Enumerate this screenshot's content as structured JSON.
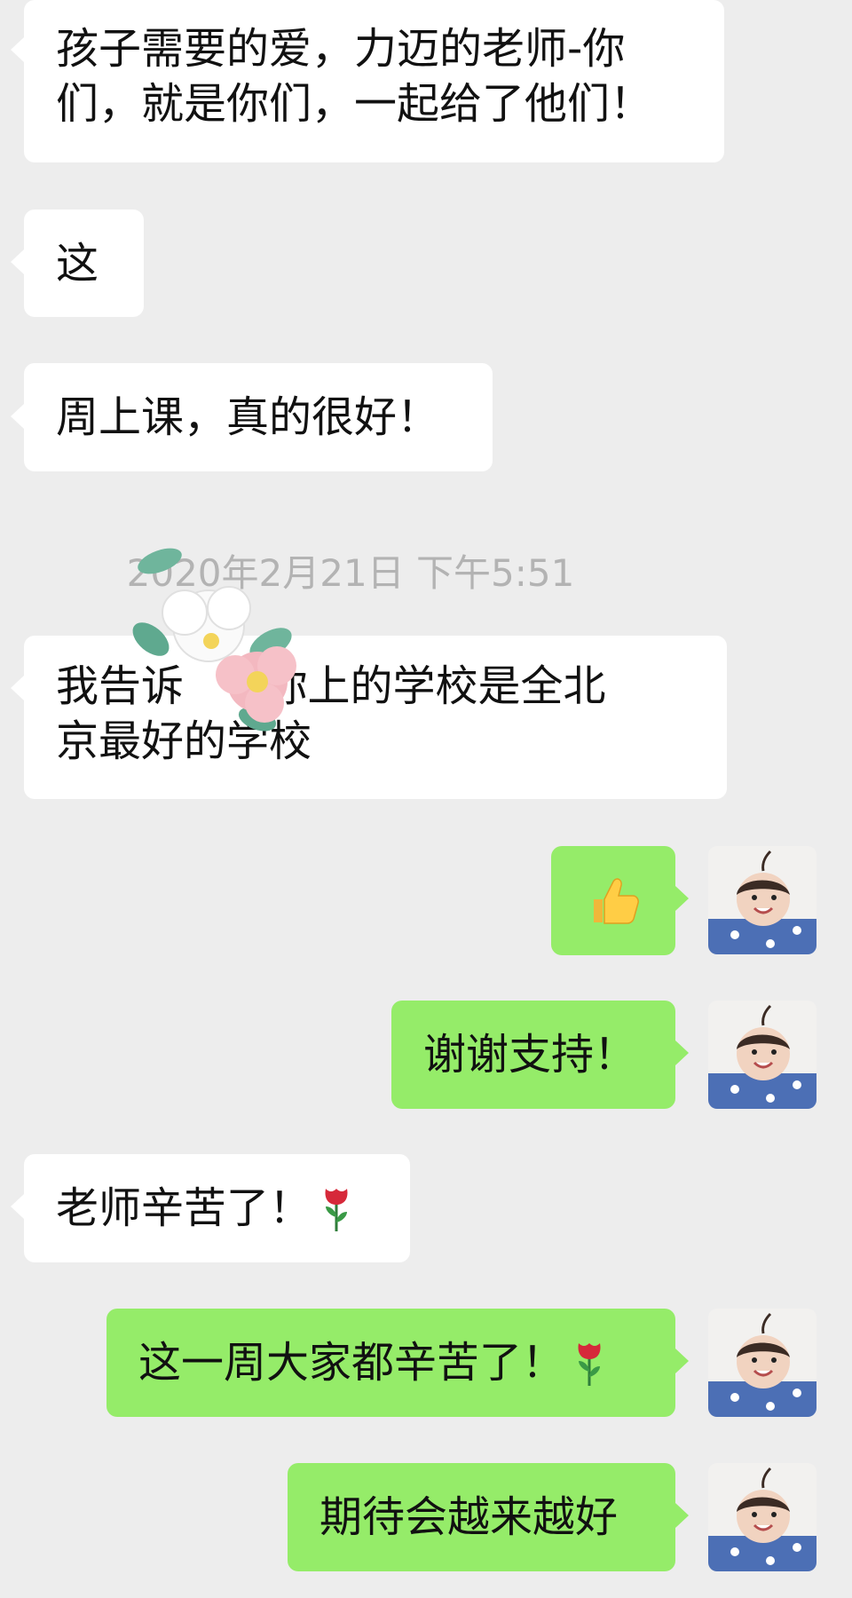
{
  "messages": {
    "m1_line1": "孩子需要的爱，力迈的老师-你",
    "m1_line2": "们，就是你们，一起给了他们！",
    "m2": "这",
    "m3": "周上课，真的很好！",
    "timestamp": "2020年2月21日 下午5:51",
    "m4_line1": "我告诉      你上的学校是全北",
    "m4_line2": "京最好的学校",
    "m5_emoji": "thumbs-up",
    "m6": "谢谢支持！",
    "m7": "老师辛苦了！",
    "m7_emoji": "rose",
    "m8": "这一周大家都辛苦了！",
    "m8_emoji": "rose",
    "m9": "期待会越来越好"
  },
  "colors": {
    "background": "#ededed",
    "incoming_bubble": "#ffffff",
    "outgoing_bubble": "#95ec69",
    "timestamp_text": "#b3b3b3"
  }
}
